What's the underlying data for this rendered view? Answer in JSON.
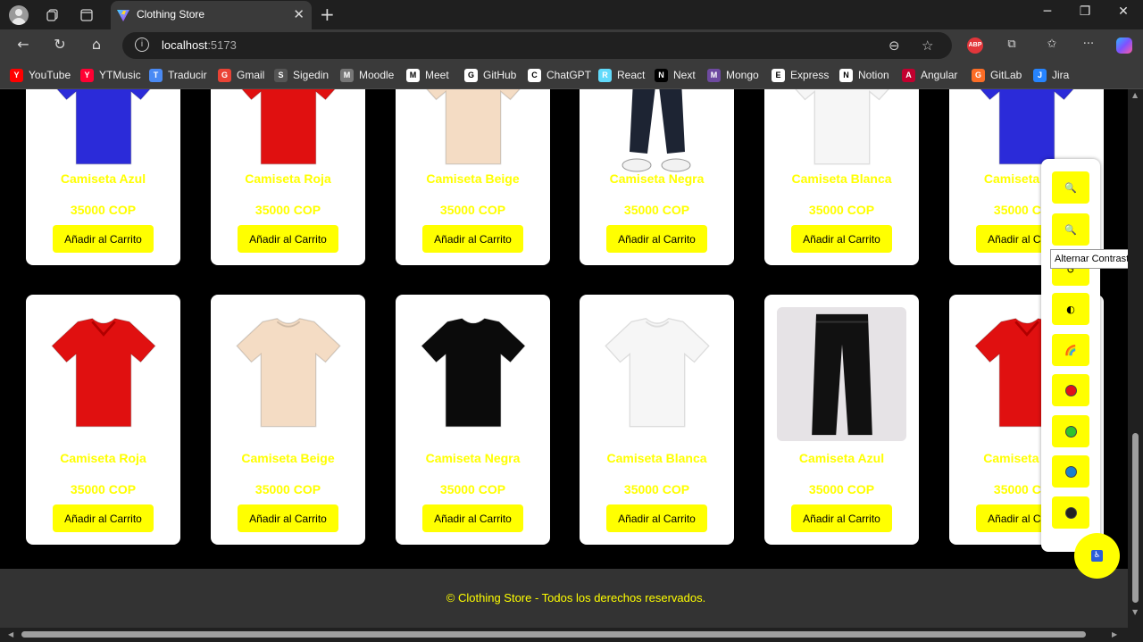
{
  "browser": {
    "tab_title": "Clothing Store",
    "url_host": "localhost",
    "url_port": ":5173",
    "extension_abp_label": "ABP",
    "bookmarks": [
      {
        "label": "YouTube",
        "icon": "youtube-icon",
        "color": "#ff0000"
      },
      {
        "label": "YTMusic",
        "icon": "ytmusic-icon",
        "color": "#ff0033"
      },
      {
        "label": "Traducir",
        "icon": "translate-icon",
        "color": "#4a8af4"
      },
      {
        "label": "Gmail",
        "icon": "gmail-icon",
        "color": "#ea4335"
      },
      {
        "label": "Sigedin",
        "icon": "globe-icon",
        "color": "#555555"
      },
      {
        "label": "Moodle",
        "icon": "moodle-icon",
        "color": "#777777"
      },
      {
        "label": "Meet",
        "icon": "google-icon",
        "color": "#ffffff"
      },
      {
        "label": "GitHub",
        "icon": "github-icon",
        "color": "#ffffff"
      },
      {
        "label": "ChatGPT",
        "icon": "chatgpt-icon",
        "color": "#ffffff"
      },
      {
        "label": "React",
        "icon": "react-icon",
        "color": "#61dafb"
      },
      {
        "label": "Next",
        "icon": "next-icon",
        "color": "#000000"
      },
      {
        "label": "Mongo",
        "icon": "mongo-icon",
        "color": "#6e4aa0"
      },
      {
        "label": "Express",
        "icon": "express-icon",
        "color": "#ffffff"
      },
      {
        "label": "Notion",
        "icon": "notion-icon",
        "color": "#ffffff"
      },
      {
        "label": "Angular",
        "icon": "angular-icon",
        "color": "#c3002f"
      },
      {
        "label": "GitLab",
        "icon": "gitlab-icon",
        "color": "#fc6d26"
      },
      {
        "label": "Jira",
        "icon": "jira-icon",
        "color": "#2684ff"
      }
    ]
  },
  "store": {
    "button_label": "Añadir al Carrito",
    "top_row": [
      {
        "name": "Camiseta Azul",
        "price": "35000 COP",
        "color": "#2b2bd9"
      },
      {
        "name": "Camiseta Roja",
        "price": "35000 COP",
        "color": "#e01010"
      },
      {
        "name": "Camiseta Beige",
        "price": "35000 COP",
        "color": "#f4dcc4"
      },
      {
        "name": "Camiseta Negra",
        "price": "35000 COP",
        "color": "#1d2433"
      },
      {
        "name": "Camiseta Blanca",
        "price": "35000 COP",
        "color": "#f6f6f6"
      },
      {
        "name": "Camiseta Azul",
        "price": "35000 COP",
        "color": "#2b2bd9"
      }
    ],
    "bottom_row": [
      {
        "name": "Camiseta Roja",
        "price": "35000 COP",
        "color": "#e01010"
      },
      {
        "name": "Camiseta Beige",
        "price": "35000 COP",
        "color": "#f4dcc4"
      },
      {
        "name": "Camiseta Negra",
        "price": "35000 COP",
        "color": "#0b0b0b"
      },
      {
        "name": "Camiseta Blanca",
        "price": "35000 COP",
        "color": "#f6f6f6"
      },
      {
        "name": "Camiseta Azul",
        "price": "35000 COP",
        "color": "#111111"
      },
      {
        "name": "Camiseta Roja",
        "price": "35000 COP",
        "color": "#e01010"
      }
    ],
    "footer": "© Clothing Store - Todos los derechos reservados."
  },
  "accessibility": {
    "tooltip": "Alternar Contraste",
    "buttons": [
      "zoom-in-icon",
      "zoom-out-icon",
      "reset-icon",
      "contrast-icon",
      "rainbow-icon",
      "red-dot-icon",
      "green-dot-icon",
      "blue-dot-icon",
      "dark-dot-icon"
    ],
    "dot_colors": [
      "#e0101a",
      "#2ec42e",
      "#1a7fd0",
      "#222222"
    ]
  }
}
